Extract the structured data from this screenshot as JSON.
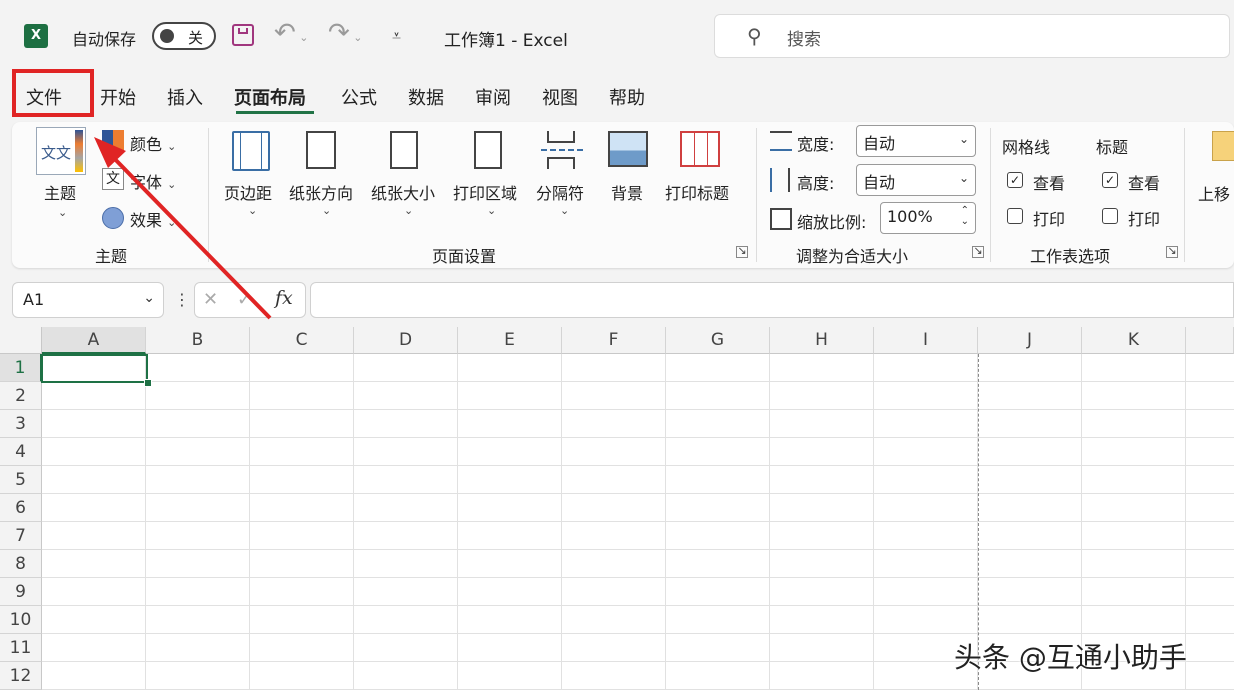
{
  "titlebar": {
    "app_icon": "X",
    "autosave_label": "自动保存",
    "autosave_state": "关",
    "doc_title": "工作簿1  -  Excel",
    "search_placeholder": "搜索"
  },
  "tabs": [
    "文件",
    "开始",
    "插入",
    "页面布局",
    "公式",
    "数据",
    "审阅",
    "视图",
    "帮助"
  ],
  "active_tab": "页面布局",
  "ribbon": {
    "theme_group": {
      "label": "主题",
      "theme_button": "主题",
      "theme_icon_text": "文文",
      "colors": "颜色",
      "fonts": "字体",
      "effects": "效果",
      "fonts_icon_text": "文"
    },
    "page_setup": {
      "label": "页面设置",
      "margins": "页边距",
      "orientation": "纸张方向",
      "size": "纸张大小",
      "print_area": "打印区域",
      "breaks": "分隔符",
      "background": "背景",
      "print_titles": "打印标题"
    },
    "scale_to_fit": {
      "label": "调整为合适大小",
      "width_label": "宽度:",
      "width_value": "自动",
      "height_label": "高度:",
      "height_value": "自动",
      "scale_label": "缩放比例:",
      "scale_value": "100%"
    },
    "sheet_options": {
      "label": "工作表选项",
      "gridlines": "网格线",
      "headings": "标题",
      "view": "查看",
      "print": "打印"
    },
    "arrange": {
      "bring_forward": "上移"
    }
  },
  "formula_bar": {
    "name_box": "A1",
    "fx": "fx",
    "cancel": "✕",
    "enter": "✓",
    "formula": ""
  },
  "columns": [
    "A",
    "B",
    "C",
    "D",
    "E",
    "F",
    "G",
    "H",
    "I",
    "J",
    "K"
  ],
  "rows": [
    "1",
    "2",
    "3",
    "4",
    "5",
    "6",
    "7",
    "8",
    "9",
    "10",
    "11",
    "12"
  ],
  "watermark": "头条 @互通小助手",
  "colors": {
    "excel_green": "#217346",
    "annotation_red": "#e02424"
  }
}
